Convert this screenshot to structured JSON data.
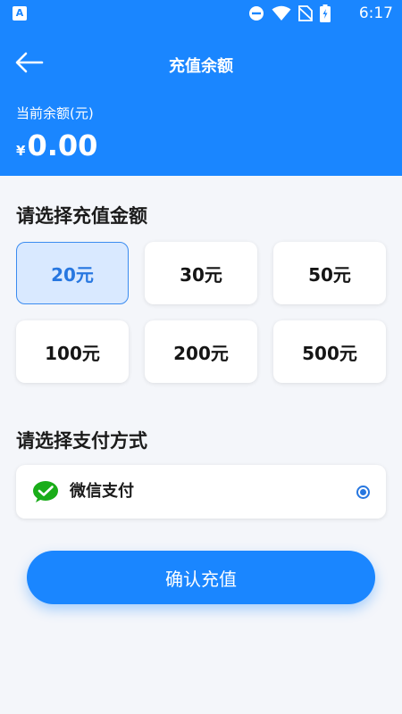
{
  "status_bar": {
    "time": "6:17",
    "icons": [
      "app-notification-icon",
      "do-not-disturb-icon",
      "wifi-icon",
      "no-sim-icon",
      "battery-charging-icon"
    ]
  },
  "header": {
    "back_icon": "arrow-left-icon",
    "title": "充值余额",
    "balance_label": "当前余额(元)",
    "currency_symbol": "¥",
    "balance_value": "0.00"
  },
  "amount_section": {
    "title": "请选择充值金额",
    "options": [
      "20元",
      "30元",
      "50元",
      "100元",
      "200元",
      "500元"
    ],
    "selected": "20元"
  },
  "payment_section": {
    "title": "请选择支付方式",
    "method": {
      "label": "微信支付",
      "icon": "wechat-pay-icon",
      "selected": true
    }
  },
  "confirm_button": {
    "label": "确认充值"
  },
  "colors": {
    "primary": "#1a86ff",
    "selected_bg": "#d9e9ff",
    "selected_text": "#2777e0",
    "wechat_green": "#1aad19",
    "page_bg": "#f4f6fa"
  }
}
